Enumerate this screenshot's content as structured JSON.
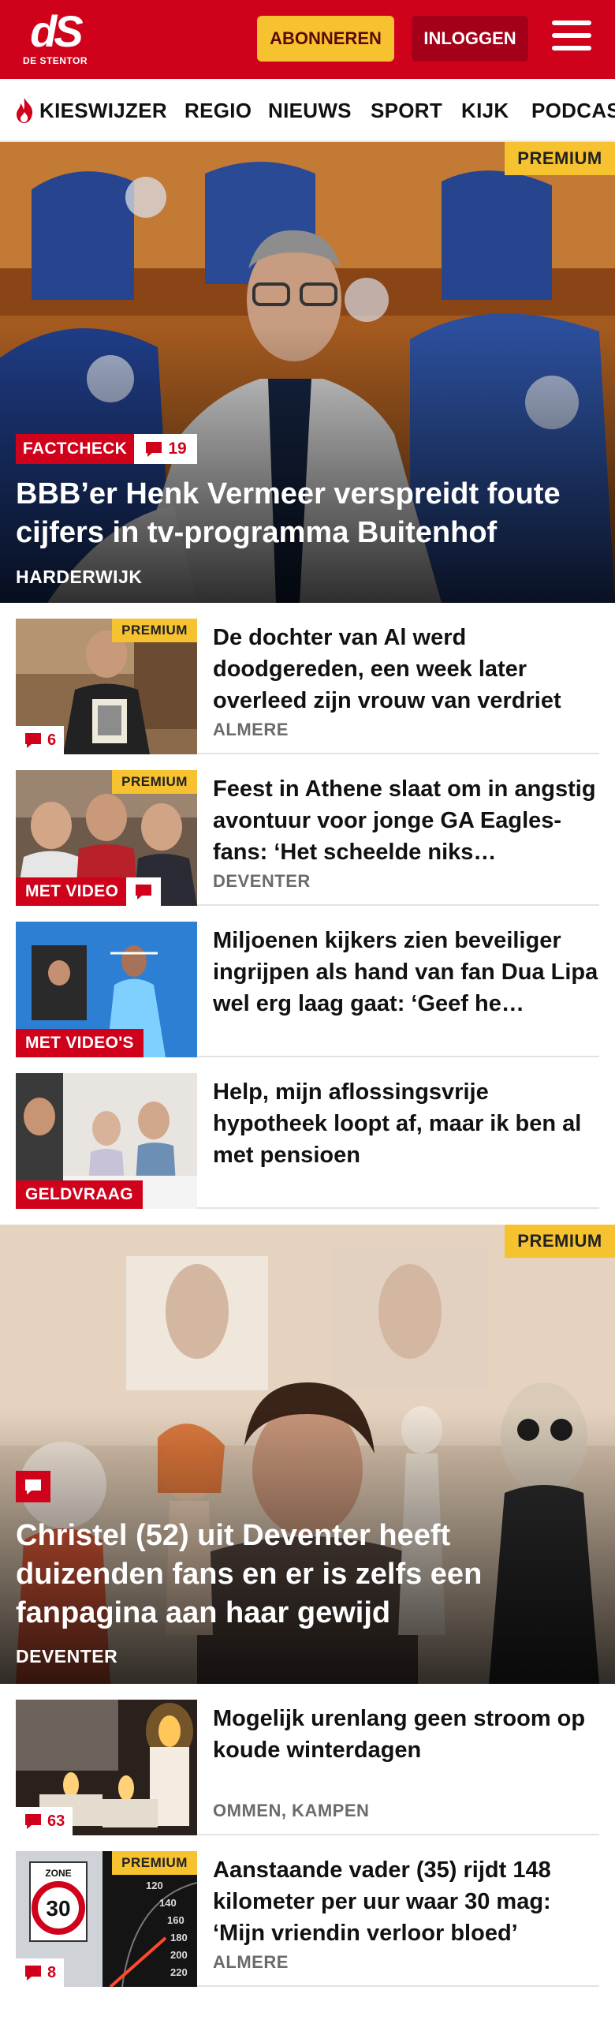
{
  "header": {
    "logo_mark": "dS",
    "logo_sub": "DE STENTOR",
    "subscribe_label": "ABONNEREN",
    "login_label": "INLOGGEN"
  },
  "nav": {
    "items": [
      "KIESWIJZER",
      "REGIO",
      "NIEUWS",
      "SPORT",
      "KIJK",
      "PODCAST"
    ]
  },
  "colors": {
    "brand_red": "#d0021b",
    "premium_yellow": "#f6c230",
    "dark_red": "#a5001a"
  },
  "hero1": {
    "premium": "PREMIUM",
    "tag": "FACTCHECK",
    "comments": "19",
    "title": "BBB’er Henk Vermeer verspreidt foute cijfers in tv-programma Buitenhof",
    "location": "HARDERWIJK"
  },
  "list1": [
    {
      "title": "De dochter van Al werd doodgereden, een week later overleed zijn vrouw van verdriet",
      "location": "ALMERE",
      "premium": "PREMIUM",
      "comments": "6"
    },
    {
      "title": "Feest in Athene slaat om in angstig avontuur voor jonge GA Eagles-fans: ‘Het scheelde niks…",
      "location": "DEVENTER",
      "premium": "PREMIUM",
      "tag": "MET VIDEO"
    },
    {
      "title": "Miljoenen kijkers zien beveiliger ingrijpen als hand van fan Dua Lipa wel erg laag gaat: ‘Geef he…",
      "tag": "MET VIDEO'S"
    },
    {
      "title": "Help, mijn aflossingsvrije hypotheek loopt af, maar ik ben al met pensioen",
      "tag": "GELDVRAAG"
    }
  ],
  "hero2": {
    "premium": "PREMIUM",
    "title": "Christel (52) uit Deventer heeft duizenden fans en er is zelfs een fanpagina aan haar gewijd",
    "location": "DEVENTER"
  },
  "list2": [
    {
      "title": "Mogelijk urenlang geen stroom op koude winterdagen",
      "location": "OMMEN, KAMPEN",
      "comments": "63"
    },
    {
      "title": "Aanstaande vader (35) rijdt 148 kilometer per uur waar 30 mag: ‘Mijn vriendin verloor bloed’",
      "location": "ALMERE",
      "premium": "PREMIUM",
      "comments": "8",
      "sign_word": "ZONE",
      "sign_number": "30",
      "speedo": [
        "120",
        "140",
        "160",
        "180",
        "200",
        "220"
      ]
    }
  ]
}
